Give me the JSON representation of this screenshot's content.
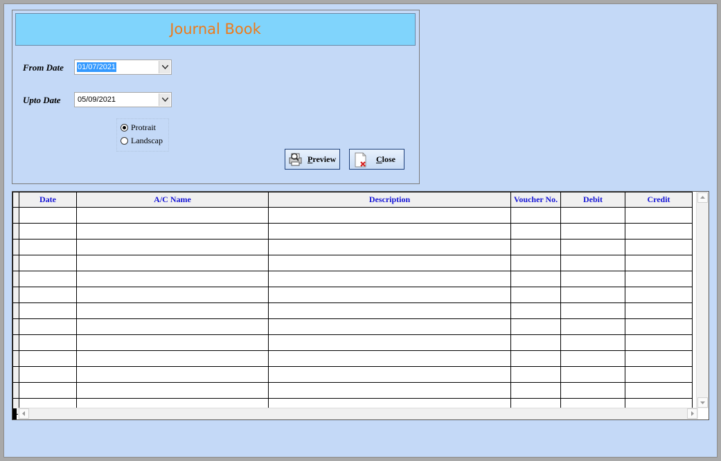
{
  "form": {
    "title": "Journal Book",
    "from_date_label": "From Date",
    "from_date_value": "01/07/2021",
    "upto_date_label": "Upto Date",
    "upto_date_value": "05/09/2021",
    "orientation_options": [
      {
        "label": "Protrait",
        "checked": true
      },
      {
        "label": "Landscap",
        "checked": false
      }
    ],
    "preview_button": {
      "hotkey": "P",
      "rest": "review"
    },
    "close_button": {
      "hotkey": "C",
      "rest": "lose"
    }
  },
  "grid": {
    "columns": [
      "Date",
      "A/C Name",
      "Description",
      "Voucher No.",
      "Debit",
      "Credit"
    ],
    "empty_rows": 13
  },
  "colors": {
    "background": "#c4d9f7",
    "title_bar": "#80d4fc",
    "title_text": "#ee7a1a",
    "header_text": "#1515d6",
    "selection": "#3399ff"
  },
  "icons": [
    "preview-printer-icon",
    "close-document-icon",
    "dropdown-arrow-icon"
  ]
}
